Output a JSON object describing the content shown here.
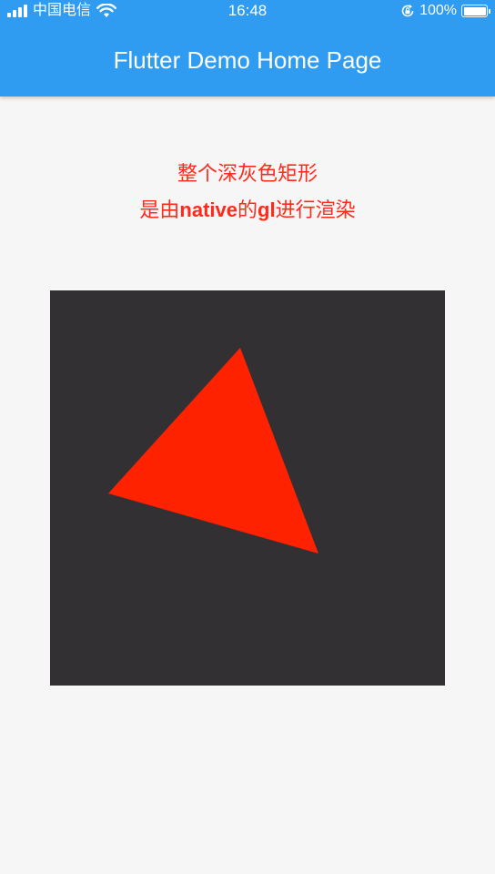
{
  "status_bar": {
    "carrier": "中国电信",
    "time": "16:48",
    "battery_percent": "100%",
    "battery_level": 1.0
  },
  "app_bar": {
    "title": "Flutter Demo Home Page",
    "color": "#2f9bf1"
  },
  "content": {
    "caption_line1": "整个深灰色矩形",
    "caption_line2_before": "是由",
    "caption_line2_native": "native",
    "caption_line2_mid": "的",
    "caption_line2_gl": "gl",
    "caption_line2_after": "进行渲染",
    "caption_color": "#ff2a1a"
  },
  "gl_view": {
    "background_color": "#333033",
    "triangle_color": "#ff2200"
  }
}
